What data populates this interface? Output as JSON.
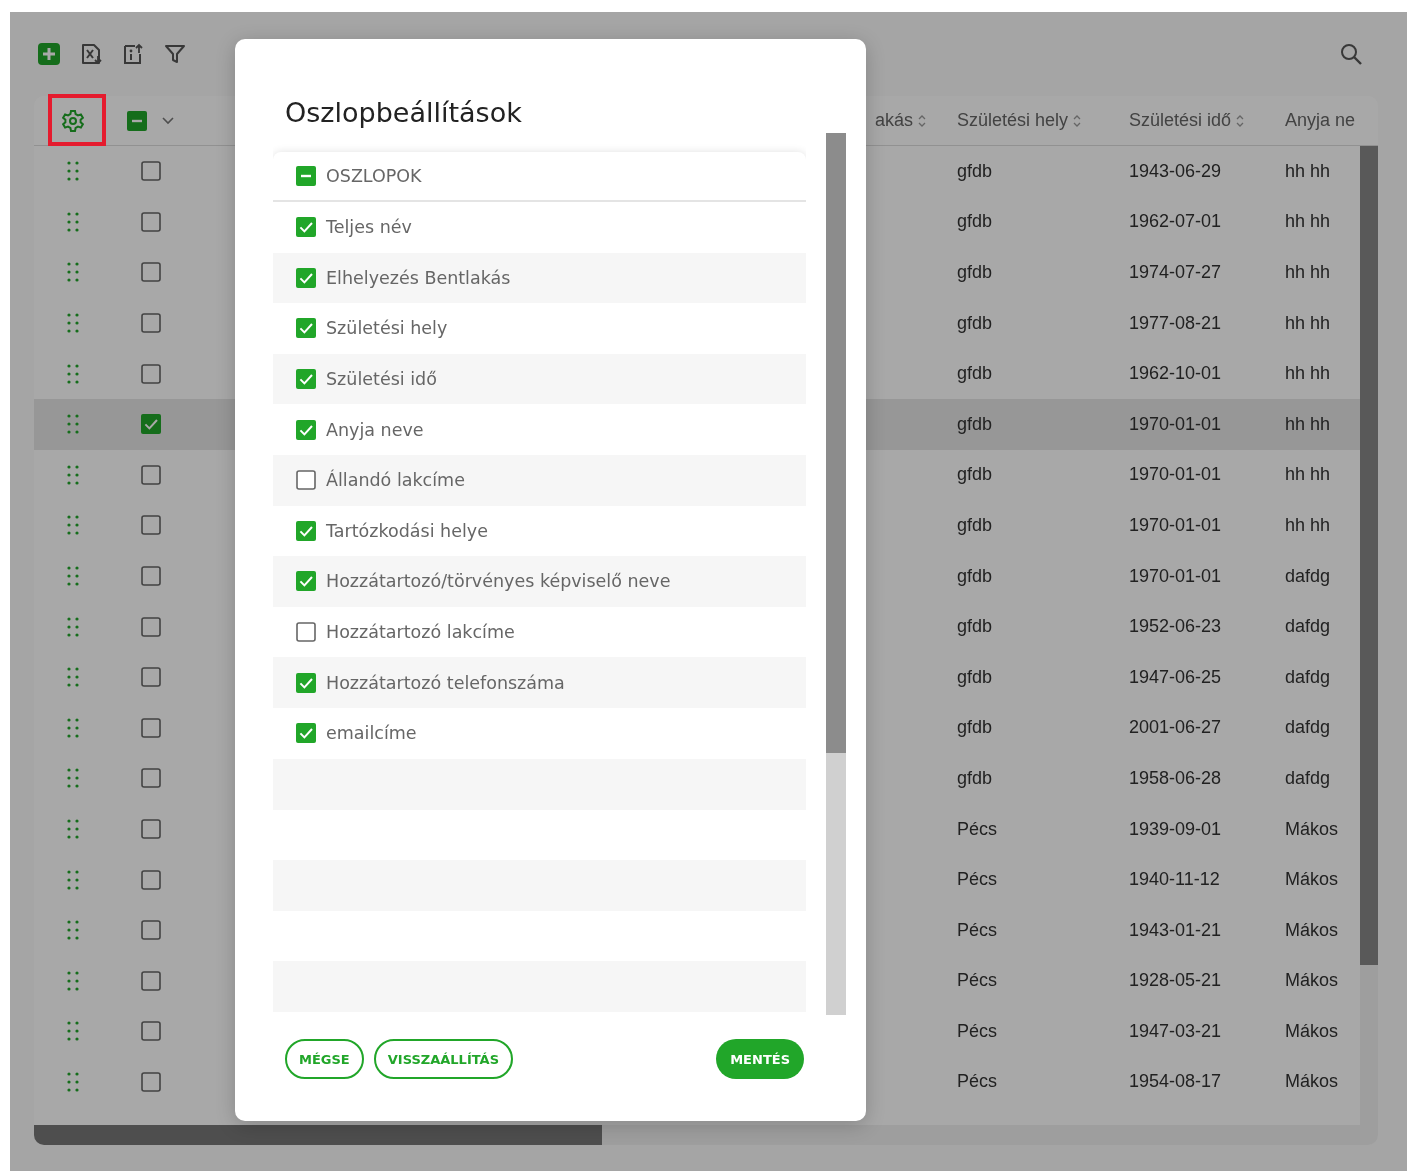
{
  "table": {
    "settings_highlighted": true,
    "select_all_indeterminate": true,
    "columns": [
      {
        "label": "akás",
        "sortable": true
      },
      {
        "label": "Születési hely",
        "sortable": true
      },
      {
        "label": "Születési idő",
        "sortable": true
      },
      {
        "label": "Anyja ne",
        "sortable": false
      }
    ],
    "rows": [
      {
        "selected": false,
        "checked": false,
        "cells": [
          "",
          "gfdb",
          "1943-06-29",
          "hh hh"
        ]
      },
      {
        "selected": false,
        "checked": false,
        "cells": [
          "",
          "gfdb",
          "1962-07-01",
          "hh hh"
        ]
      },
      {
        "selected": false,
        "checked": false,
        "cells": [
          "",
          "gfdb",
          "1974-07-27",
          "hh hh"
        ]
      },
      {
        "selected": false,
        "checked": false,
        "cells": [
          "",
          "gfdb",
          "1977-08-21",
          "hh hh"
        ]
      },
      {
        "selected": false,
        "checked": false,
        "cells": [
          "",
          "gfdb",
          "1962-10-01",
          "hh hh"
        ]
      },
      {
        "selected": true,
        "checked": true,
        "cells": [
          "",
          "gfdb",
          "1970-01-01",
          "hh hh"
        ]
      },
      {
        "selected": false,
        "checked": false,
        "cells": [
          "",
          "gfdb",
          "1970-01-01",
          "hh hh"
        ]
      },
      {
        "selected": false,
        "checked": false,
        "cells": [
          "",
          "gfdb",
          "1970-01-01",
          "hh hh"
        ]
      },
      {
        "selected": false,
        "checked": false,
        "cells": [
          "",
          "gfdb",
          "1970-01-01",
          "dafdg"
        ]
      },
      {
        "selected": false,
        "checked": false,
        "cells": [
          "",
          "gfdb",
          "1952-06-23",
          "dafdg"
        ]
      },
      {
        "selected": false,
        "checked": false,
        "cells": [
          "",
          "gfdb",
          "1947-06-25",
          "dafdg"
        ]
      },
      {
        "selected": false,
        "checked": false,
        "cells": [
          "",
          "gfdb",
          "2001-06-27",
          "dafdg"
        ]
      },
      {
        "selected": false,
        "checked": false,
        "cells": [
          "",
          "gfdb",
          "1958-06-28",
          "dafdg"
        ]
      },
      {
        "selected": false,
        "checked": false,
        "cells": [
          "",
          "Pécs",
          "1939-09-01",
          "Mákos"
        ]
      },
      {
        "selected": false,
        "checked": false,
        "cells": [
          "",
          "Pécs",
          "1940-11-12",
          "Mákos"
        ]
      },
      {
        "selected": false,
        "checked": false,
        "cells": [
          "",
          "Pécs",
          "1943-01-21",
          "Mákos"
        ]
      },
      {
        "selected": false,
        "checked": false,
        "cells": [
          "",
          "Pécs",
          "1928-05-21",
          "Mákos"
        ]
      },
      {
        "selected": false,
        "checked": false,
        "cells": [
          "",
          "Pécs",
          "1947-03-21",
          "Mákos"
        ]
      },
      {
        "selected": false,
        "checked": false,
        "cells": [
          "",
          "Pécs",
          "1954-08-17",
          "Mákos"
        ]
      }
    ]
  },
  "dialog": {
    "title": "Oszlopbeállítások",
    "group": {
      "label": "OSZLOPOK",
      "indeterminate": true
    },
    "items": [
      {
        "label": "Teljes név",
        "checked": true
      },
      {
        "label": "Elhelyezés Bentlakás",
        "checked": true
      },
      {
        "label": "Születési hely",
        "checked": true
      },
      {
        "label": "Születési idő",
        "checked": true
      },
      {
        "label": "Anyja neve",
        "checked": true
      },
      {
        "label": "Állandó lakcíme",
        "checked": false
      },
      {
        "label": "Tartózkodási helye",
        "checked": true
      },
      {
        "label": "Hozzátartozó/törvényes képviselő neve",
        "checked": true
      },
      {
        "label": "Hozzátartozó lakcíme",
        "checked": false
      },
      {
        "label": "Hozzátartozó telefonszáma",
        "checked": true
      },
      {
        "label": "emailcíme",
        "checked": true
      }
    ],
    "buttons": [
      {
        "label": "MÉGSE",
        "kind": "outline"
      },
      {
        "label": "VISSZAÁLLÍTÁS",
        "kind": "outline"
      },
      {
        "label": "MENTÉS",
        "kind": "primary"
      }
    ]
  }
}
